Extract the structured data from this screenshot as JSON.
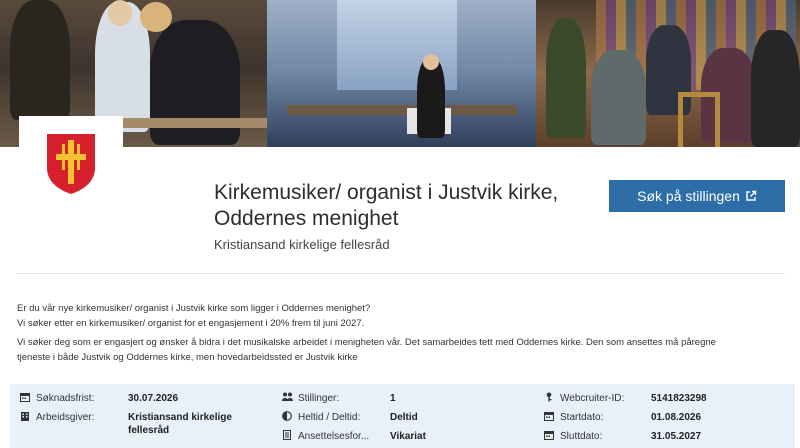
{
  "header": {
    "job_title_line1": "Kirkemusiker/ organist i Justvik kirke,",
    "job_title_line2": "Oddernes menighet",
    "employer": "Kristiansand kirkelige fellesråd",
    "apply_label": "Søk på stillingen"
  },
  "description": {
    "para1_line1": "Er du vår nye kirkemusiker/ organist i Justvik kirke som ligger i Oddernes menighet?",
    "para1_line2": "Vi søker etter en kirkemusiker/ organist for et engasjement i 20% frem til juni 2027.",
    "para2_line1": "Vi søker deg som er engasjert og ønsker å bidra i det musikalske arbeidet i menigheten vår. Det samarbeides tett med Oddernes kirke. Den som ansettes må påregne",
    "para2_line2": "tjeneste i både Justvik og Oddernes kirke, men hovedarbeidssted er Justvik kirke"
  },
  "info": {
    "soknadsfrist_label": "Søknadsfrist:",
    "soknadsfrist_value": "30.07.2026",
    "arbeidsgiver_label": "Arbeidsgiver:",
    "arbeidsgiver_value_line1": "Kristiansand kirkelige",
    "arbeidsgiver_value_line2": "fellesråd",
    "stillinger_label": "Stillinger:",
    "stillinger_value": "1",
    "heltid_label": "Heltid / Deltid:",
    "heltid_value": "Deltid",
    "ansettelse_label": "Ansettelsesfor...",
    "ansettelse_value": "Vikariat",
    "webcruiter_label": "Webcruiter-ID:",
    "webcruiter_value": "5141823298",
    "startdato_label": "Startdato:",
    "startdato_value": "01.08.2026",
    "sluttdato_label": "Sluttdato:",
    "sluttdato_value": "31.05.2027"
  },
  "icons": {
    "calendar": "calendar-icon",
    "building": "building-icon",
    "people": "people-icon",
    "clock": "half-circle-icon",
    "document": "document-icon",
    "key": "key-icon",
    "external": "external-link-icon"
  },
  "colors": {
    "accent": "#2d6ea8",
    "panel": "#e8f1fa",
    "logo_red": "#d6202d",
    "logo_gold": "#f2c230"
  }
}
